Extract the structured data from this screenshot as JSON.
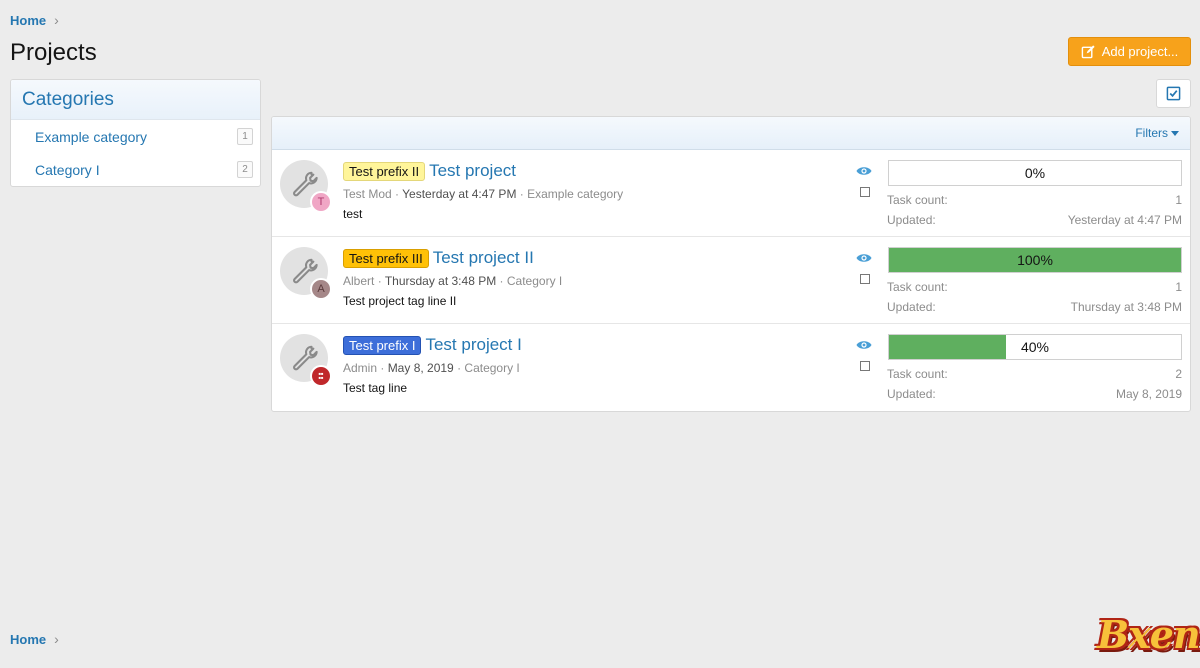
{
  "breadcrumb": {
    "home": "Home"
  },
  "page": {
    "title": "Projects"
  },
  "actions": {
    "add_project": "Add project..."
  },
  "sidebar": {
    "title": "Categories",
    "items": [
      {
        "label": "Example category",
        "count": "1"
      },
      {
        "label": "Category I",
        "count": "2"
      }
    ]
  },
  "list": {
    "filters_label": "Filters",
    "task_count_label": "Task count:",
    "updated_label": "Updated:",
    "projects": [
      {
        "prefix": "Test prefix II",
        "title": "Test project",
        "author": "Test Mod",
        "date": "Yesterday at 4:47 PM",
        "category": "Example category",
        "tagline": "test",
        "avatar_letter": "T",
        "progress": 0,
        "progress_text": "0%",
        "task_count": "1",
        "updated": "Yesterday at 4:47 PM"
      },
      {
        "prefix": "Test prefix III",
        "title": "Test project II",
        "author": "Albert",
        "date": "Thursday at 3:48 PM",
        "category": "Category I",
        "tagline": "Test project tag line II",
        "avatar_letter": "A",
        "progress": 100,
        "progress_text": "100%",
        "task_count": "1",
        "updated": "Thursday at 3:48 PM"
      },
      {
        "prefix": "Test prefix I",
        "title": "Test project I",
        "author": "Admin",
        "date": "May 8, 2019",
        "category": "Category I",
        "tagline": "Test tag line",
        "avatar_letter": "",
        "progress": 40,
        "progress_text": "40%",
        "task_count": "2",
        "updated": "May 8, 2019"
      }
    ]
  },
  "icons": {
    "add": "edit-icon",
    "toggle": "check-square-icon",
    "project": "wrench-icon",
    "watch": "eye-icon"
  },
  "colors": {
    "link": "#2577b1",
    "accent_button": "#f7a21b",
    "progress_fill": "#5faf5f",
    "prefix_yellow": "#fff59a",
    "prefix_orange": "#ffc107",
    "prefix_blue": "#3d6ed9"
  },
  "watermark": "Bxen"
}
